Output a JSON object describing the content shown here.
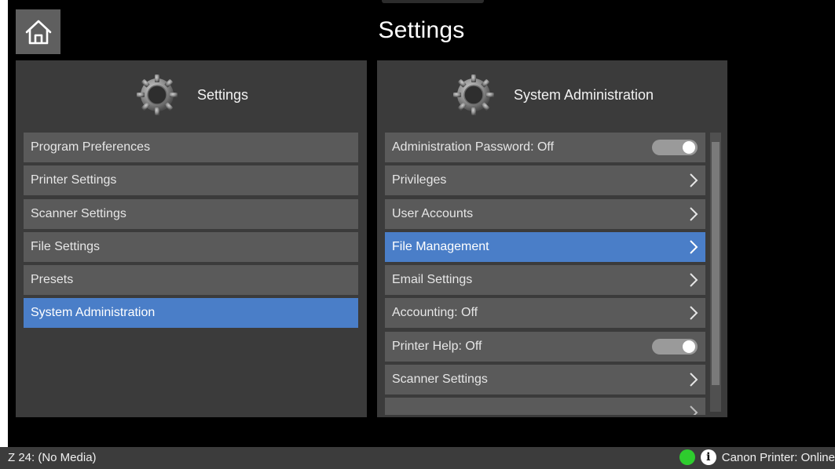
{
  "header": {
    "title": "Settings"
  },
  "left_panel": {
    "title": "Settings",
    "items": [
      {
        "label": "Program Preferences"
      },
      {
        "label": "Printer Settings"
      },
      {
        "label": "Scanner Settings"
      },
      {
        "label": "File Settings"
      },
      {
        "label": "Presets"
      },
      {
        "label": "System Administration",
        "selected": true
      }
    ]
  },
  "right_panel": {
    "title": "System Administration",
    "items": [
      {
        "label": "Administration Password: Off",
        "control": "toggle"
      },
      {
        "label": "Privileges",
        "control": "chevron"
      },
      {
        "label": "User Accounts",
        "control": "chevron"
      },
      {
        "label": "File Management",
        "control": "chevron",
        "selected": true
      },
      {
        "label": "Email Settings",
        "control": "chevron"
      },
      {
        "label": "Accounting: Off",
        "control": "chevron"
      },
      {
        "label": "Printer Help: Off",
        "control": "toggle"
      },
      {
        "label": "Scanner Settings",
        "control": "chevron"
      }
    ]
  },
  "status_bar": {
    "left": "Z 24: (No Media)",
    "right": "Canon Printer: Online",
    "status_color": "#2ecc2e"
  },
  "colors": {
    "accent": "#4a7ec8",
    "panel": "#3b3b3b",
    "item": "#5a5a5a"
  },
  "icons": {
    "home": "home-icon",
    "gear": "gear-icon",
    "chevron": "chevron-right-icon",
    "info": "info-icon"
  }
}
